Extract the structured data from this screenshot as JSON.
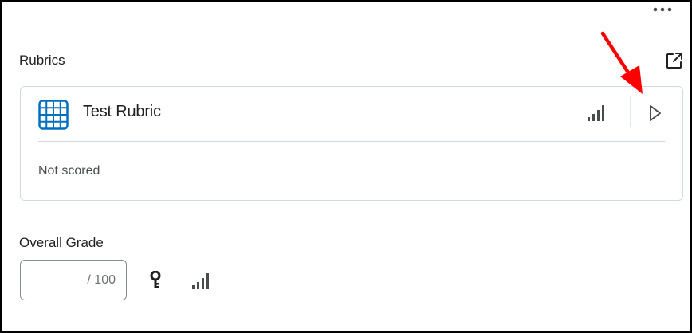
{
  "more_menu": {
    "icon": "more-horizontal-icon"
  },
  "rubrics": {
    "title": "Rubrics",
    "popout_icon": "external-link-icon",
    "card": {
      "icon": "grid-table-icon",
      "name": "Test Rubric",
      "signal_icon": "signal-bars-icon",
      "expand_icon": "play-triangle-icon",
      "status": "Not scored"
    }
  },
  "overall_grade": {
    "title": "Overall Grade",
    "value": "",
    "max": "/ 100",
    "key_icon": "key-icon",
    "signal_icon": "signal-bars-icon"
  },
  "annotation": {
    "arrow_color": "#ff0000"
  },
  "colors": {
    "rubric_icon_blue": "#006fbf",
    "card_border": "#d3d9e3",
    "text_primary": "#202122",
    "icon_gray": "#494c4e"
  }
}
